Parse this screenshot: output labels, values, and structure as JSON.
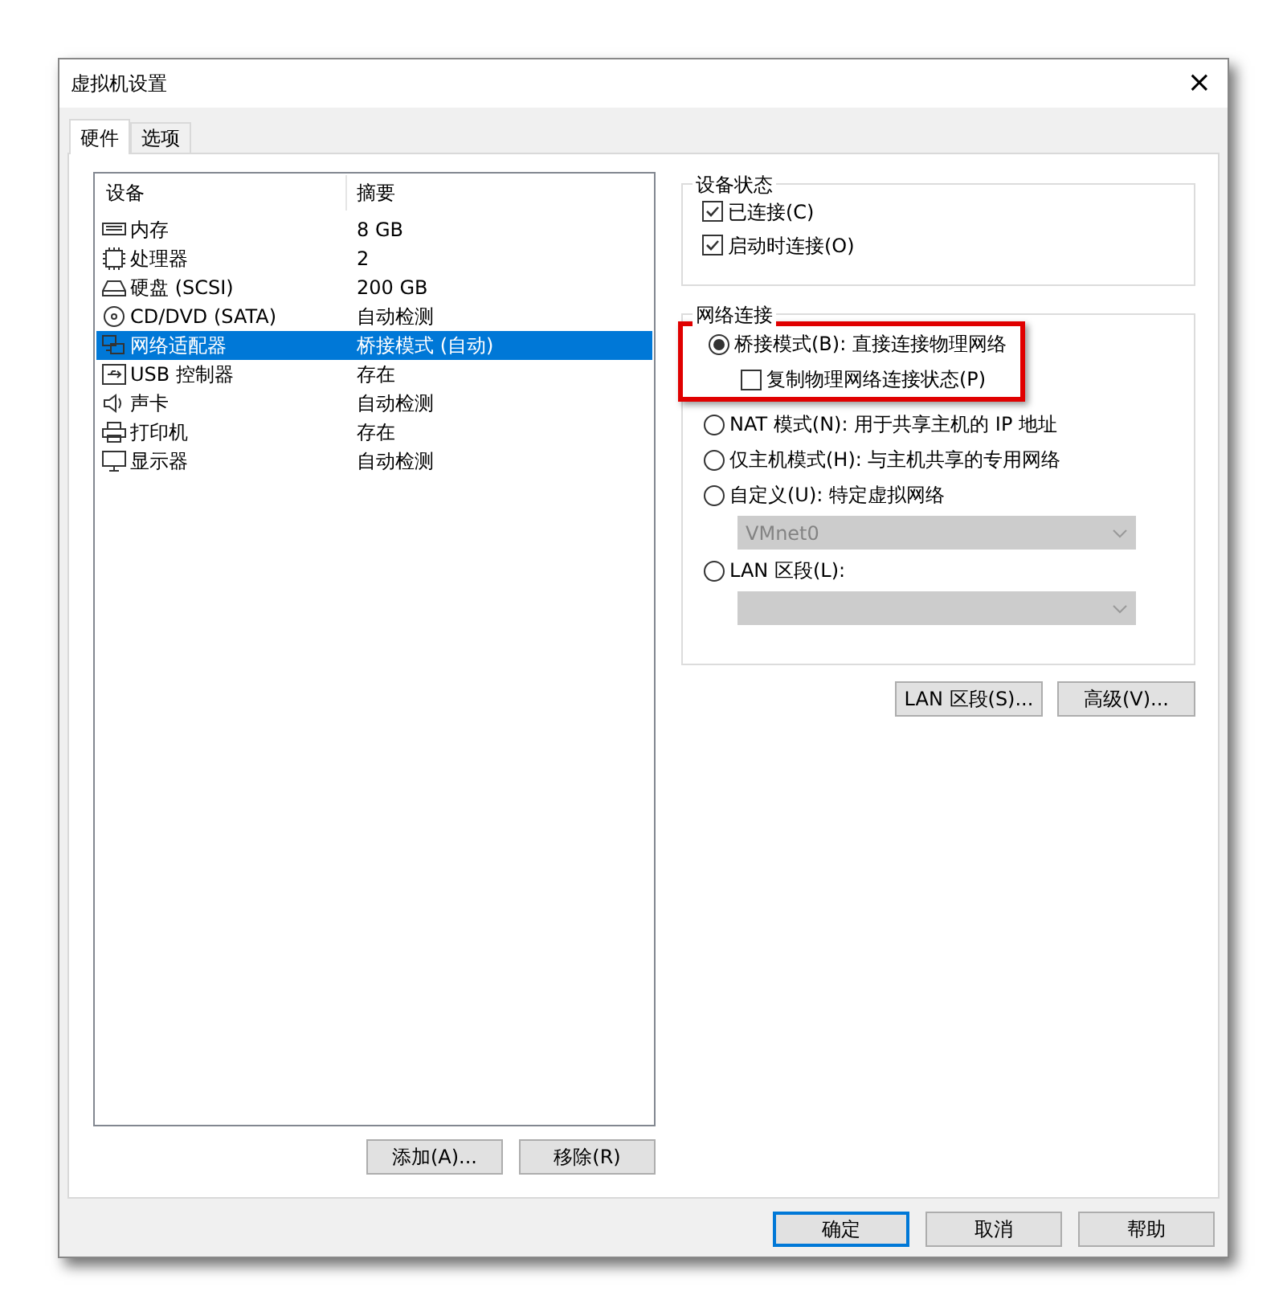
{
  "window": {
    "title": "虚拟机设置",
    "close": "×"
  },
  "tabs": [
    {
      "label": "硬件",
      "selected": true
    },
    {
      "label": "选项",
      "selected": false
    }
  ],
  "device_list": {
    "columns": [
      "设备",
      "摘要"
    ],
    "rows": [
      {
        "kind": "memory",
        "device": "内存",
        "summary": "8 GB",
        "selected": false
      },
      {
        "kind": "cpu",
        "device": "处理器",
        "summary": "2",
        "selected": false
      },
      {
        "kind": "disk",
        "device": "硬盘 (SCSI)",
        "summary": "200 GB",
        "selected": false
      },
      {
        "kind": "cd",
        "device": "CD/DVD (SATA)",
        "summary": "自动检测",
        "selected": false
      },
      {
        "kind": "network",
        "device": "网络适配器",
        "summary": "桥接模式 (自动)",
        "selected": true
      },
      {
        "kind": "usb",
        "device": "USB 控制器",
        "summary": "存在",
        "selected": false
      },
      {
        "kind": "sound",
        "device": "声卡",
        "summary": "自动检测",
        "selected": false
      },
      {
        "kind": "printer",
        "device": "打印机",
        "summary": "存在",
        "selected": false
      },
      {
        "kind": "display",
        "device": "显示器",
        "summary": "自动检测",
        "selected": false
      }
    ]
  },
  "list_buttons": [
    "添加(A)...",
    "移除(R)"
  ],
  "device_status": {
    "title": "设备状态",
    "options": [
      {
        "label": "已连接(C)",
        "checked": true
      },
      {
        "label": "启动时连接(O)",
        "checked": true
      }
    ]
  },
  "network": {
    "title": "网络连接",
    "highlighted_options": [
      {
        "kind": "radio",
        "label": "桥接模式(B): 直接连接物理网络",
        "selected": true
      },
      {
        "kind": "checkbox",
        "label": "复制物理网络连接状态(P)",
        "checked": false
      }
    ],
    "options": [
      {
        "kind": "radio",
        "label": "NAT 模式(N): 用于共享主机的 IP 地址",
        "selected": false
      },
      {
        "kind": "radio",
        "label": "仅主机模式(H): 与主机共享的专用网络",
        "selected": false
      },
      {
        "kind": "radio",
        "label": "自定义(U): 特定虚拟网络",
        "selected": false
      },
      {
        "kind": "dropdown",
        "value": "VMnet0",
        "disabled": true
      },
      {
        "kind": "radio",
        "label": "LAN 区段(L):",
        "selected": false
      },
      {
        "kind": "dropdown",
        "disabled": true
      }
    ]
  },
  "network_buttons": [
    "LAN 区段(S)...",
    "高级(V)..."
  ],
  "dialog_buttons": [
    {
      "label": "确定",
      "default": true
    },
    {
      "label": "取消",
      "default": false
    },
    {
      "label": "帮助",
      "default": false
    }
  ]
}
